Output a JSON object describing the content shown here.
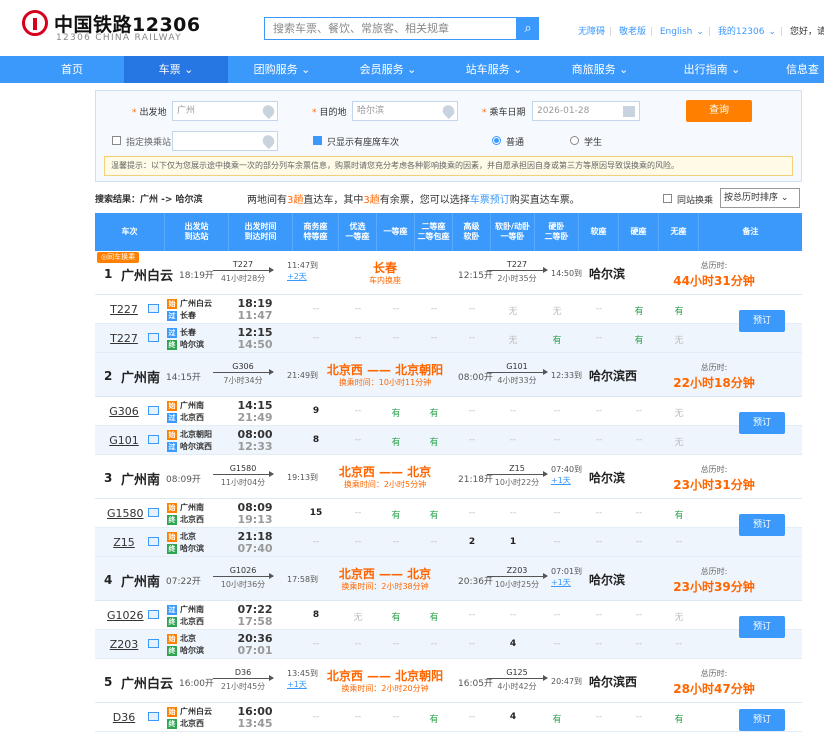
{
  "header": {
    "brand": "中国铁路12306",
    "brand_sub": "12306 CHINA RAILWAY",
    "search_placeholder": "搜索车票、餐饮、常旅客、相关规章",
    "links": [
      "无障碍",
      "敬老版",
      "English",
      "我的12306",
      "您好，请"
    ]
  },
  "nav": {
    "items": [
      "首页",
      "车票 ⌄",
      "团购服务 ⌄",
      "会员服务 ⌄",
      "站车服务 ⌄",
      "商旅服务 ⌄",
      "出行指南 ⌄",
      "信息查"
    ]
  },
  "query": {
    "from_label": "出发地",
    "from_value": "广州",
    "to_label": "目的地",
    "to_value": "哈尔滨",
    "date_label": "乘车日期",
    "date_value": "2026-01-28",
    "submit": "查询",
    "transfer_label": "指定换乘站",
    "only_seats": "只显示有座席车次",
    "normal": "普通",
    "student": "学生",
    "notice": "温馨提示：以下仅为您展示途中换乘一次的部分列车余票信息，购票时请您充分考虑各种影响换乘的因素，并自愿承担因自身或第三方等原因导致误换乘的风险。"
  },
  "results": {
    "prefix": "搜索结果：",
    "route": "广州 -> 哈尔滨",
    "s1": "两地间有",
    "n1": "3趟",
    "s2": "直达车，其中",
    "n2": "3趟",
    "s3": "有余票，您可以选择",
    "link": "车票预订",
    "s4": "购买直达车票。",
    "same_station": "同站换乘",
    "sort": "按总历时排序  ⌄"
  },
  "columns": [
    "车次",
    "出发站\n到达站",
    "出发时间\n到达时间",
    "商务座\n特等座",
    "优选\n一等座",
    "一等座",
    "二等座\n二等包座",
    "高级\n软卧",
    "软卧/动卧\n一等卧",
    "硬卧\n二等卧",
    "软座",
    "硬座",
    "无座",
    "备注"
  ],
  "labels": {
    "total": "总历时:",
    "book": "预订",
    "transfer_badge": "◎同车换乘"
  },
  "journeys": [
    {
      "seq": "1",
      "from": "广州白云",
      "dep": "18:19开",
      "t1": "T227",
      "d1": "41小时28分",
      "arr1": "11:47到",
      "plus1": "+2天",
      "xfer": "长春",
      "xnote": "车内换座",
      "dep2": "12:15开",
      "t2": "T227",
      "d2": "2小时35分",
      "arr2": "14:50到",
      "plus2": "",
      "to": "哈尔滨",
      "total": "44小时31分钟",
      "badge": true,
      "legs": [
        {
          "no": "T227",
          "s1": "广州白云",
          "s2": "长春",
          "b1": "始",
          "b2": "过",
          "tm1": "18:19",
          "tm2": "11:47",
          "seats": [
            "--",
            "--",
            "--",
            "--",
            "--",
            "无",
            "无",
            "--",
            "有",
            "有"
          ]
        },
        {
          "no": "T227",
          "s1": "长春",
          "s2": "哈尔滨",
          "b1": "过",
          "b2": "终",
          "tm1": "12:15",
          "tm2": "14:50",
          "seats": [
            "--",
            "--",
            "--",
            "--",
            "--",
            "无",
            "有",
            "--",
            "有",
            "无"
          ]
        }
      ]
    },
    {
      "seq": "2",
      "from": "广州南",
      "dep": "14:15开",
      "t1": "G306",
      "d1": "7小时34分",
      "arr1": "21:49到",
      "plus1": "",
      "xfer": "北京西 —— 北京朝阳",
      "xnote": "换乘时间：10小时11分钟",
      "dep2": "08:00开",
      "t2": "G101",
      "d2": "4小时33分",
      "arr2": "12:33到",
      "plus2": "",
      "to": "哈尔滨西",
      "total": "22小时18分钟",
      "badge": false,
      "legs": [
        {
          "no": "G306",
          "s1": "广州南",
          "s2": "北京西",
          "b1": "始",
          "b2": "过",
          "tm1": "14:15",
          "tm2": "21:49",
          "seats": [
            "9",
            "--",
            "有",
            "有",
            "--",
            "--",
            "--",
            "--",
            "--",
            "无"
          ]
        },
        {
          "no": "G101",
          "s1": "北京朝阳",
          "s2": "哈尔滨西",
          "b1": "始",
          "b2": "过",
          "tm1": "08:00",
          "tm2": "12:33",
          "seats": [
            "8",
            "--",
            "有",
            "有",
            "--",
            "--",
            "--",
            "--",
            "--",
            "无"
          ]
        }
      ]
    },
    {
      "seq": "3",
      "from": "广州南",
      "dep": "08:09开",
      "t1": "G1580",
      "d1": "11小时04分",
      "arr1": "19:13到",
      "plus1": "",
      "xfer": "北京西 —— 北京",
      "xnote": "换乘时间：2小时5分钟",
      "dep2": "21:18开",
      "t2": "Z15",
      "d2": "10小时22分",
      "arr2": "07:40到",
      "plus2": "+1天",
      "to": "哈尔滨",
      "total": "23小时31分钟",
      "badge": false,
      "legs": [
        {
          "no": "G1580",
          "s1": "广州南",
          "s2": "北京西",
          "b1": "始",
          "b2": "终",
          "tm1": "08:09",
          "tm2": "19:13",
          "seats": [
            "15",
            "--",
            "有",
            "有",
            "--",
            "--",
            "--",
            "--",
            "--",
            "有"
          ]
        },
        {
          "no": "Z15",
          "s1": "北京",
          "s2": "哈尔滨",
          "b1": "始",
          "b2": "终",
          "tm1": "21:18",
          "tm2": "07:40",
          "seats": [
            "--",
            "--",
            "--",
            "--",
            "2",
            "1",
            "--",
            "--",
            "--",
            "--"
          ]
        }
      ]
    },
    {
      "seq": "4",
      "from": "广州南",
      "dep": "07:22开",
      "t1": "G1026",
      "d1": "10小时36分",
      "arr1": "17:58到",
      "plus1": "",
      "xfer": "北京西 —— 北京",
      "xnote": "换乘时间：2小时38分钟",
      "dep2": "20:36开",
      "t2": "Z203",
      "d2": "10小时25分",
      "arr2": "07:01到",
      "plus2": "+1天",
      "to": "哈尔滨",
      "total": "23小时39分钟",
      "badge": false,
      "legs": [
        {
          "no": "G1026",
          "s1": "广州南",
          "s2": "北京西",
          "b1": "过",
          "b2": "终",
          "tm1": "07:22",
          "tm2": "17:58",
          "seats": [
            "8",
            "无",
            "有",
            "有",
            "--",
            "--",
            "--",
            "--",
            "--",
            "无"
          ]
        },
        {
          "no": "Z203",
          "s1": "北京",
          "s2": "哈尔滨",
          "b1": "始",
          "b2": "终",
          "tm1": "20:36",
          "tm2": "07:01",
          "seats": [
            "--",
            "--",
            "--",
            "--",
            "--",
            "4",
            "--",
            "--",
            "--",
            "--"
          ]
        }
      ]
    },
    {
      "seq": "5",
      "from": "广州白云",
      "dep": "16:00开",
      "t1": "D36",
      "d1": "21小时45分",
      "arr1": "13:45到",
      "plus1": "+1天",
      "xfer": "北京西 —— 北京朝阳",
      "xnote": "换乘时间：2小时20分钟",
      "dep2": "16:05开",
      "t2": "G125",
      "d2": "4小时42分",
      "arr2": "20:47到",
      "plus2": "",
      "to": "哈尔滨西",
      "total": "28小时47分钟",
      "badge": false,
      "legs": [
        {
          "no": "D36",
          "s1": "广州白云",
          "s2": "北京西",
          "b1": "始",
          "b2": "终",
          "tm1": "16:00",
          "tm2": "13:45",
          "seats": [
            "--",
            "--",
            "--",
            "有",
            "--",
            "4",
            "有",
            "--",
            "--",
            "有"
          ]
        }
      ]
    }
  ]
}
